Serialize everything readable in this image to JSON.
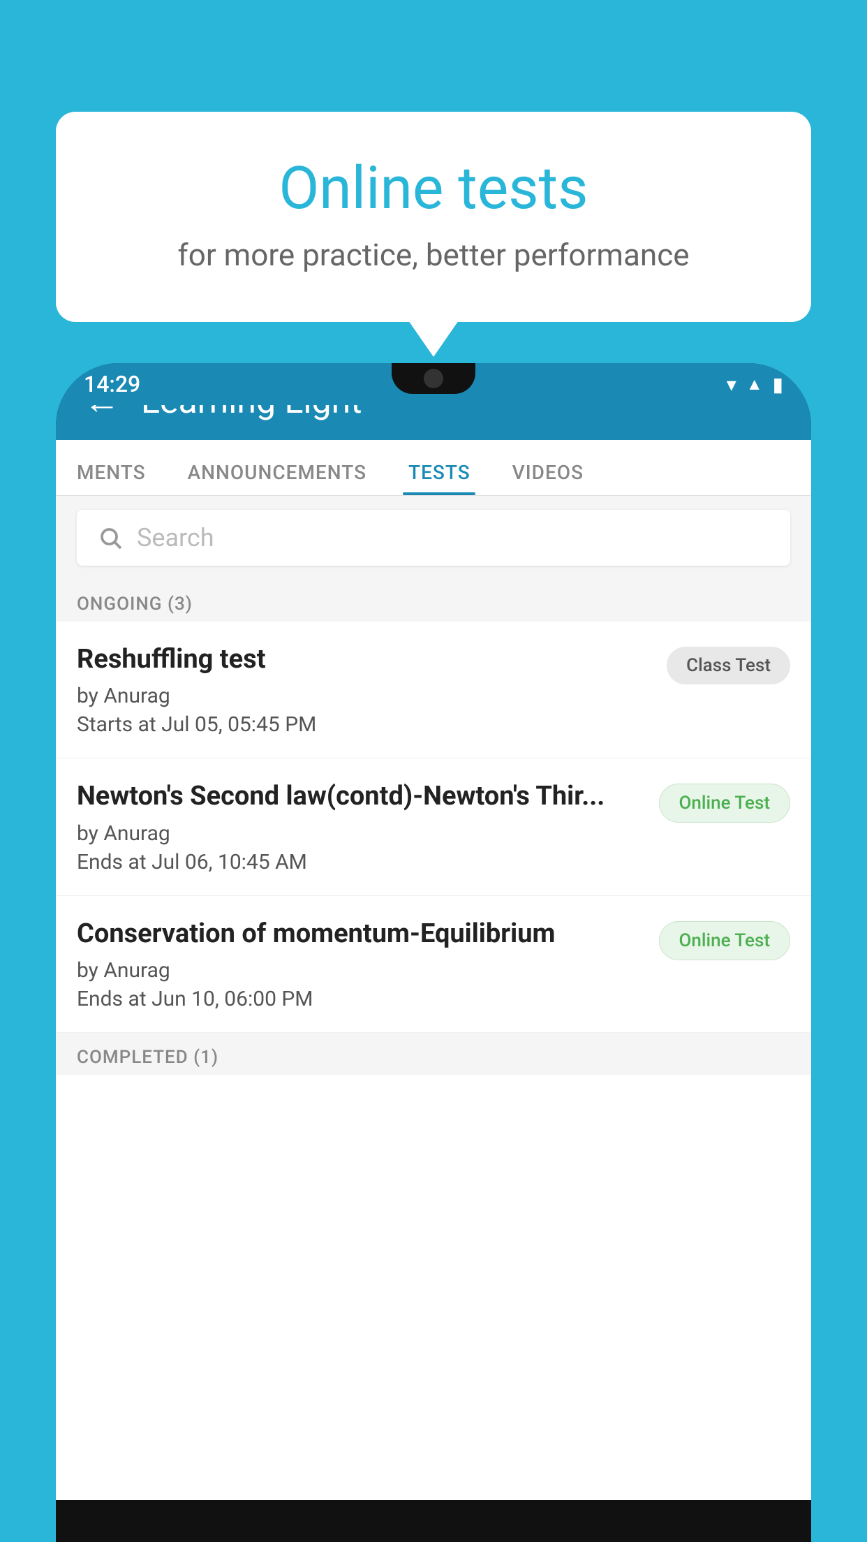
{
  "background": {
    "color": "#29b6d8"
  },
  "speech_bubble": {
    "title": "Online tests",
    "subtitle": "for more practice, better performance"
  },
  "status_bar": {
    "time": "14:29",
    "wifi": "wifi",
    "signal": "signal",
    "battery": "battery"
  },
  "app_header": {
    "back_label": "←",
    "title": "Learning Light"
  },
  "tabs": [
    {
      "label": "MENTS",
      "active": false
    },
    {
      "label": "ANNOUNCEMENTS",
      "active": false
    },
    {
      "label": "TESTS",
      "active": true
    },
    {
      "label": "VIDEOS",
      "active": false
    }
  ],
  "search": {
    "placeholder": "Search"
  },
  "ongoing_section": {
    "label": "ONGOING (3)"
  },
  "test_items": [
    {
      "title": "Reshuffling test",
      "author": "by Anurag",
      "date_label": "Starts at",
      "date": "Jul 05, 05:45 PM",
      "badge": "Class Test",
      "badge_type": "class"
    },
    {
      "title": "Newton's Second law(contd)-Newton's Thir...",
      "author": "by Anurag",
      "date_label": "Ends at",
      "date": "Jul 06, 10:45 AM",
      "badge": "Online Test",
      "badge_type": "online"
    },
    {
      "title": "Conservation of momentum-Equilibrium",
      "author": "by Anurag",
      "date_label": "Ends at",
      "date": "Jun 10, 06:00 PM",
      "badge": "Online Test",
      "badge_type": "online"
    }
  ],
  "completed_section": {
    "label": "COMPLETED (1)"
  }
}
